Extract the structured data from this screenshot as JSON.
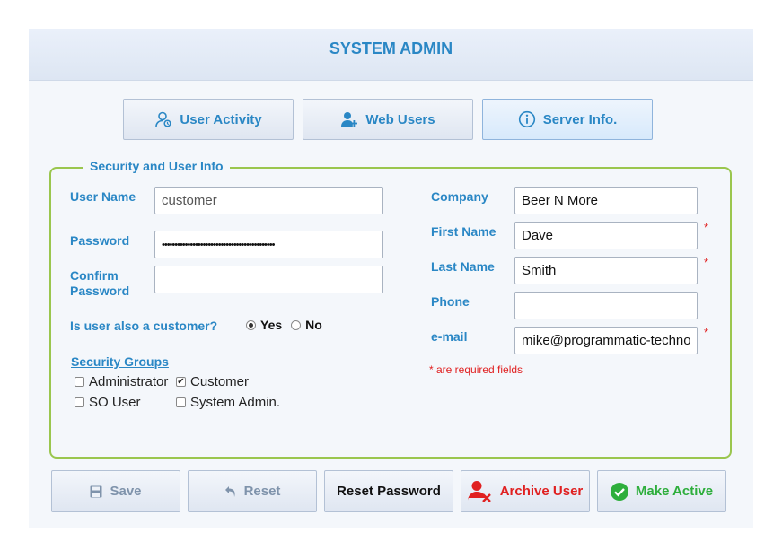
{
  "header": {
    "title": "SYSTEM ADMIN"
  },
  "tabs": [
    {
      "label": "User Activity",
      "icon": "user-activity-icon"
    },
    {
      "label": "Web Users",
      "icon": "add-user-icon"
    },
    {
      "label": "Server Info.",
      "icon": "info-icon",
      "active": true
    }
  ],
  "form": {
    "legend": "Security and User Info",
    "username": {
      "label": "User Name",
      "value": "customer"
    },
    "password": {
      "label": "Password",
      "value": "••••••••••••••••••••••••••••••••••••••••••••"
    },
    "confirm_password": {
      "label_line1": "Confirm",
      "label_line2": "Password",
      "value": ""
    },
    "is_customer": {
      "label": "Is user also a customer?",
      "yes": "Yes",
      "no": "No",
      "selected": "Yes"
    },
    "security_groups": {
      "label": "Security Groups",
      "items": [
        {
          "label": "Administrator",
          "checked": false
        },
        {
          "label": "Customer",
          "checked": true
        },
        {
          "label": "SO User",
          "checked": false
        },
        {
          "label": "System Admin.",
          "checked": false
        }
      ]
    },
    "company": {
      "label": "Company",
      "value": "Beer N More"
    },
    "first_name": {
      "label": "First Name",
      "value": "Dave",
      "required": true
    },
    "last_name": {
      "label": "Last Name",
      "value": "Smith",
      "required": true
    },
    "phone": {
      "label": "Phone",
      "value": ""
    },
    "email": {
      "label": "e-mail",
      "value": "mike@programmatic-technologies.com",
      "required": true
    },
    "required_mark": "*",
    "required_note": "* are required fields"
  },
  "buttons": {
    "save": "Save",
    "reset": "Reset",
    "reset_password": "Reset Password",
    "archive_user": "Archive User",
    "make_active": "Make Active"
  },
  "colors": {
    "accent": "#2a87c5",
    "border_green": "#9ac64e",
    "required_red": "#e02020",
    "archive_red": "#e02020",
    "active_green": "#2eae3c"
  }
}
